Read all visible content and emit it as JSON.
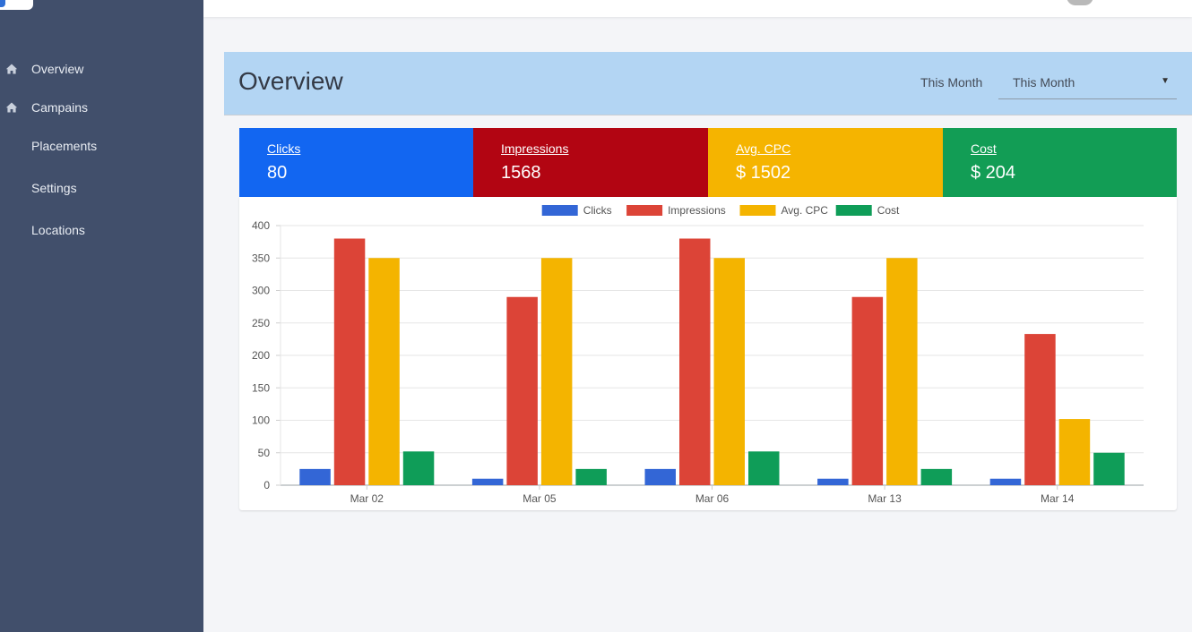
{
  "sidebar": {
    "items": [
      {
        "label": "Overview",
        "icon": "home-icon"
      },
      {
        "label": "Campains",
        "icon": "home-icon"
      },
      {
        "label": "Placements",
        "icon": ""
      },
      {
        "label": "Settings",
        "icon": ""
      },
      {
        "label": "Locations",
        "icon": ""
      }
    ]
  },
  "header": {
    "title": "Overview",
    "period_label": "This Month",
    "period_select": "This Month"
  },
  "stats": [
    {
      "name": "Clicks",
      "value": "80",
      "color": "#1266f1"
    },
    {
      "name": "Impressions",
      "value": "1568",
      "color": "#b20512"
    },
    {
      "name": "Avg. CPC",
      "value": "$ 1502",
      "color": "#f5b400"
    },
    {
      "name": "Cost",
      "value": "$ 204",
      "color": "#129d55"
    }
  ],
  "chart_data": {
    "type": "bar",
    "categories": [
      "Mar 02",
      "Mar 05",
      "Mar 06",
      "Mar 13",
      "Mar 14"
    ],
    "series": [
      {
        "name": "Clicks",
        "color": "#3366d6",
        "values": [
          25,
          10,
          25,
          10,
          10
        ]
      },
      {
        "name": "Impressions",
        "color": "#dc4437",
        "values": [
          380,
          290,
          380,
          290,
          233
        ]
      },
      {
        "name": "Avg. CPC",
        "color": "#f4b400",
        "values": [
          350,
          350,
          350,
          350,
          102
        ]
      },
      {
        "name": "Cost",
        "color": "#0f9d58",
        "values": [
          52,
          25,
          52,
          25,
          50
        ]
      }
    ],
    "yticks": [
      0,
      50,
      100,
      150,
      200,
      250,
      300,
      350,
      400
    ],
    "ylim": [
      0,
      400
    ],
    "grid": true,
    "legend": "top-center"
  }
}
